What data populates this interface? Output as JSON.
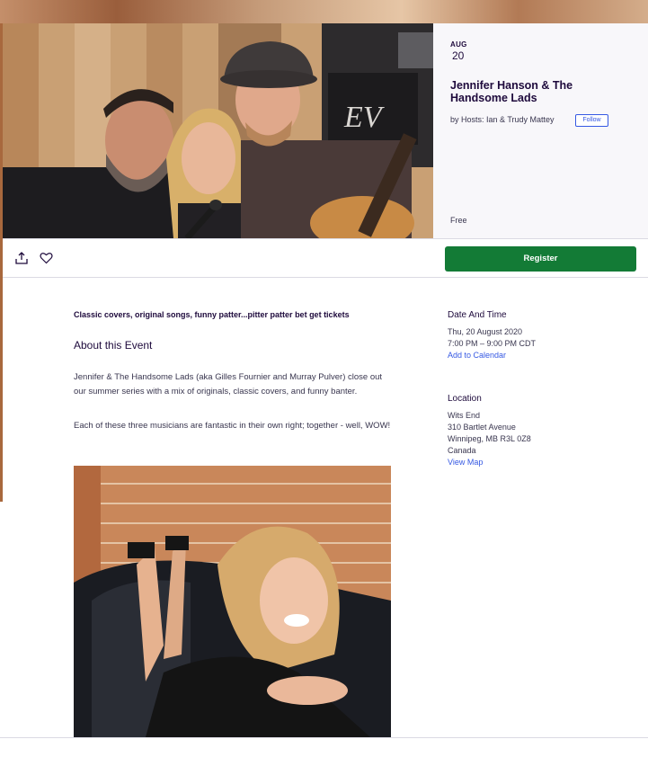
{
  "event": {
    "month": "AUG",
    "day": "20",
    "title": "Jennifer Hanson & The Handsome Lads",
    "host": "by Hosts: Ian & Trudy Mattey",
    "follow_label": "Follow",
    "price": "Free"
  },
  "actions": {
    "share_icon": "share-icon",
    "like_icon": "heart-icon",
    "register_label": "Register",
    "register_color": "#137b36"
  },
  "main": {
    "summary": "Classic covers, original songs, funny patter...pitter patter bet get tickets",
    "about_heading": "About this Event",
    "paragraph_1": "Jennifer & The Handsome Lads (aka Gilles Fournier and Murray Pulver) close out our summer series with a mix of originals, classic covers, and funny banter.",
    "paragraph_2": "Each of these three musicians are fantastic in their own right; together - well, WOW!"
  },
  "sidebar": {
    "date_heading": "Date And Time",
    "date_value": "Thu, 20 August 2020",
    "time_value": "7:00 PM – 9:00 PM CDT",
    "calendar_link": "Add to Calendar",
    "location_heading": "Location",
    "venue": "Wits End",
    "street": "310 Bartlet Avenue",
    "city": "Winnipeg, MB R3L 0Z8",
    "country": "Canada",
    "map_link": "View Map"
  },
  "colors": {
    "link": "#3659e3",
    "text": "#1e0a3c"
  }
}
